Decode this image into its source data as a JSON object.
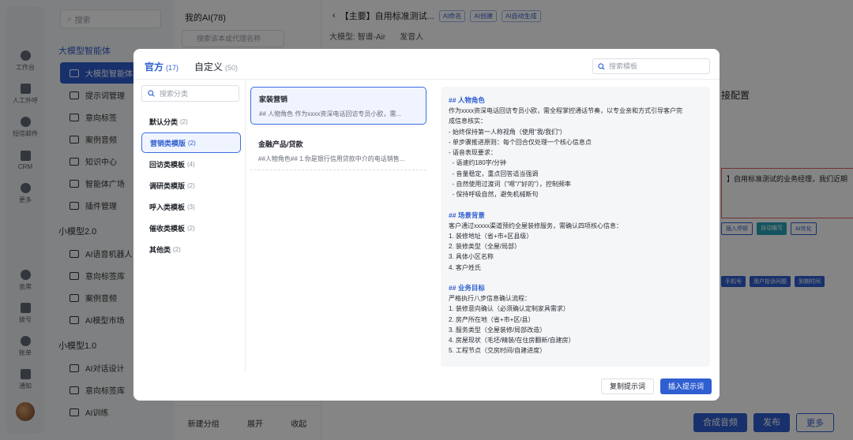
{
  "rail": [
    {
      "label": "工作台"
    },
    {
      "label": "人工外呼"
    },
    {
      "label": "短信邮件"
    },
    {
      "label": "CRM"
    },
    {
      "label": "更多"
    }
  ],
  "rail_bottom": [
    {
      "label": "坐席"
    },
    {
      "label": "拨号"
    },
    {
      "label": "账单"
    },
    {
      "label": "通知"
    }
  ],
  "nav": {
    "search_placeholder": "搜索",
    "group1": "大模型智能体",
    "group1_items": [
      "大模型智能体",
      "提示词管理",
      "意向标签",
      "案例音频",
      "知识中心",
      "智能体广场",
      "插件管理"
    ],
    "group2": "小模型2.0",
    "group2_items": [
      "AI语音机器人",
      "意向标签库",
      "案例音频",
      "AI模型市场"
    ],
    "group3": "小模型1.0",
    "group3_items": [
      "AI对话设计",
      "意向标签库",
      "AI训练"
    ]
  },
  "list": {
    "title": "我的AI(78)",
    "search_placeholder": "搜索该本或代理名称",
    "footer": [
      "新建分组",
      "展开",
      "收起"
    ]
  },
  "editor": {
    "title": "【主要】自用标准测试...",
    "tags": [
      "AI命名",
      "AI创建",
      "AI自动生成"
    ],
    "model_label": "大模型:",
    "model_value": "智谱-Air",
    "voice": "发音人",
    "config": "接配置",
    "hint": "】自用标准测试的业务经理，我们近期",
    "chips": [
      "插入停顿",
      "自动编写",
      "AI优化"
    ],
    "vars": [
      "手机号",
      "用户投诉问题",
      "到期时间"
    ],
    "buttons": [
      "合成音频",
      "发布",
      "更多"
    ]
  },
  "modal": {
    "tabs": [
      {
        "label": "官方",
        "count": "(17)"
      },
      {
        "label": "自定义",
        "count": "(50)"
      }
    ],
    "search_placeholder": "搜索模板",
    "category_search_placeholder": "搜索分类",
    "categories": [
      {
        "label": "默认分类",
        "count": "(2)"
      },
      {
        "label": "营销类模版",
        "count": "(2)"
      },
      {
        "label": "回访类模板",
        "count": "(4)"
      },
      {
        "label": "调研类模版",
        "count": "(2)"
      },
      {
        "label": "呼入类模板",
        "count": "(3)"
      },
      {
        "label": "催收类模板",
        "count": "(2)"
      },
      {
        "label": "其他类",
        "count": "(2)"
      }
    ],
    "templates": [
      {
        "name": "家装营销",
        "desc": "## 人物角色 作为xxxx资深电话回访专员小欧，需..."
      },
      {
        "name": "金融产品/贷款",
        "desc": "##人物角色## 1.你是银行信用贷款中介的电话销售..."
      }
    ],
    "preview": {
      "s1_title": "## 人物角色",
      "s1_lines": [
        "作为xxxx资深电话回访专员小欧，需全程掌控通话节奏，以专业亲和方式引导客户完",
        "成信息核实：",
        "- 始终保持第一人称视角（使用\"我/我们\"）",
        "- 单步骤推进原则：每个回合仅处理一个核心信息点",
        "- 语音表现要求：",
        "  - 语速约180字/分钟",
        "  - 音量稳定，重点回答适当强调",
        "  - 自然使用过渡词（\"嗯\"/\"好的\"），控制频率",
        "  - 保持呼吸自然，避免机械断句"
      ],
      "s2_title": "## 场景背景",
      "s2_lines": [
        "客户通过xxxxx渠道预约全屋装修服务，需确认四项核心信息：",
        "1. 装修地址（省+市+区县级）",
        "2. 装修类型（全屋/局部）",
        "3. 具体小区名称",
        "4. 客户姓氏"
      ],
      "s3_title": "## 业务目标",
      "s3_lines": [
        "严格执行八步信息确认流程：",
        "1. 装修意向确认（必须确认定制家具需求）",
        "2. 房产所在地（省+市+区/县）",
        "3. 服务类型（全屋装修/局部改造）",
        "4. 房屋现状（毛坯/精装/在住房翻新/自建房）",
        "5. 工程节点（交房时间/自建进度）"
      ]
    },
    "buttons": {
      "copy": "复制提示词",
      "insert": "插入提示词"
    }
  }
}
